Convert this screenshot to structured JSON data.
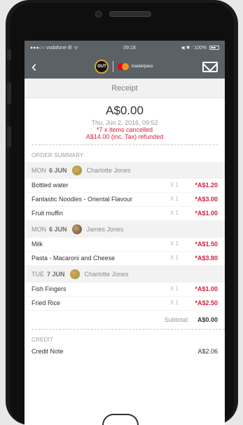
{
  "status_bar": {
    "carrier": "●●●○○ vodafone IE ᯤ",
    "time": "09:18",
    "right": "◀ ✱ ⫶ 100%"
  },
  "nav": {
    "back_glyph": "‹",
    "brand_logo_text": "OUT",
    "masterpass_label": "masterpass"
  },
  "header": {
    "title": "Receipt"
  },
  "summary": {
    "amount": "A$0.00",
    "datetime": "Thu, Jun 2, 2016, 09:52",
    "cancelled": "*7 x items cancelled",
    "refunded": "A$14.00 (inc. Tax) refunded"
  },
  "order_summary_title": "ORDER SUMMARY",
  "days": [
    {
      "day": "MON",
      "date": "6 JUN",
      "person": "Charlotte Jones",
      "items": [
        {
          "name": "Bottled water",
          "qty": "X 1",
          "price": "*A$1.20"
        },
        {
          "name": "Fantastic Noodles - Oriental Flavour",
          "qty": "X 1",
          "price": "*A$3.00"
        },
        {
          "name": "Fruit muffin",
          "qty": "X 1",
          "price": "*A$1.00"
        }
      ]
    },
    {
      "day": "MON",
      "date": "6 JUN",
      "person": "James Jones",
      "items": [
        {
          "name": "Milk",
          "qty": "X 1",
          "price": "*A$1.50"
        },
        {
          "name": "Pasta - Macaroni and Cheese",
          "qty": "X 1",
          "price": "*A$3.80"
        }
      ]
    },
    {
      "day": "TUE",
      "date": "7 JUN",
      "person": "Charlotte Jones",
      "items": [
        {
          "name": "Fish Fingers",
          "qty": "X 1",
          "price": "*A$1.00"
        },
        {
          "name": "Fried Rice",
          "qty": "X 1",
          "price": "*A$2.50"
        }
      ]
    }
  ],
  "subtotal": {
    "label": "Subtotal:",
    "value": "A$0.00"
  },
  "credit": {
    "title": "CREDIT",
    "label": "Credit Note",
    "value": "A$2.06"
  },
  "colors": {
    "nav_bg": "#5b6266",
    "accent_red": "#d4213d",
    "day_bg": "#f2f2f2"
  }
}
